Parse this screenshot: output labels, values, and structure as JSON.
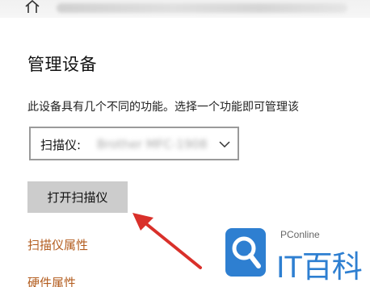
{
  "page": {
    "title": "管理设备",
    "description": "此设备具有几个不同的功能。选择一个功能即可管理该"
  },
  "scanner_select": {
    "label": "扫描仪:",
    "value": "Brother MFC-1908"
  },
  "buttons": {
    "open_scanner": "打开扫描仪"
  },
  "links": {
    "scanner_properties": "扫描仪属性",
    "hardware_properties": "硬件属性"
  },
  "watermark": {
    "small_text": "PConline",
    "big_text": "IT百科"
  },
  "colors": {
    "link": "#b35d1f",
    "button_bg": "#cccccc",
    "arrow": "#d9302a",
    "watermark_blue": "#2e7fd1"
  },
  "icons": {
    "home": "home-icon",
    "chevron": "chevron-down-icon",
    "arrow": "red-arrow-annotation"
  }
}
